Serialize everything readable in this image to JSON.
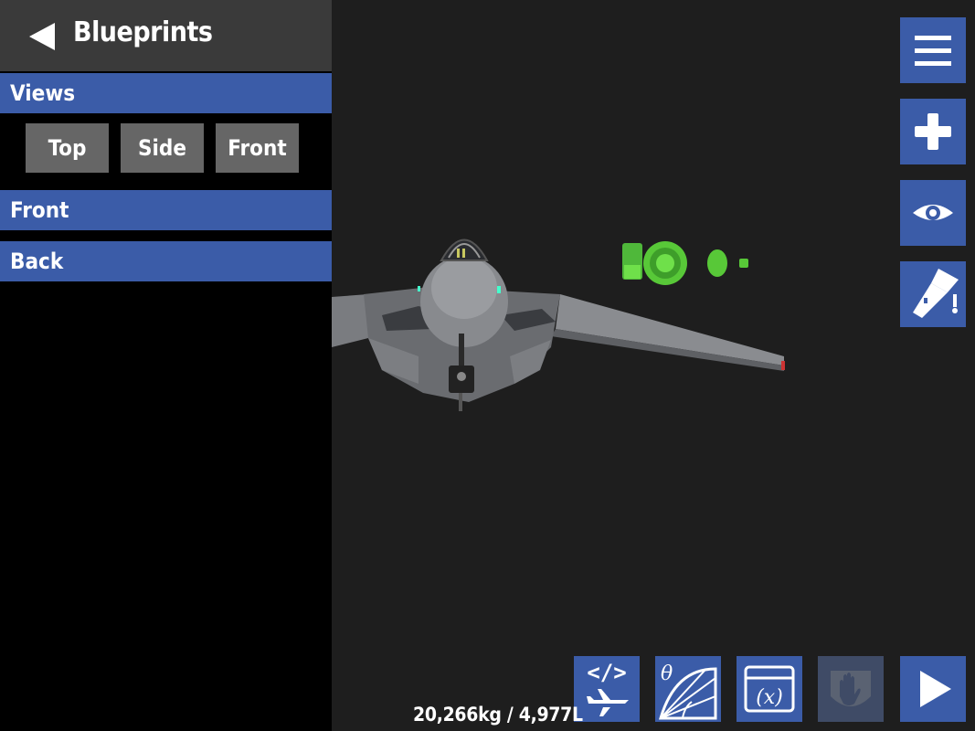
{
  "header": {
    "title": "Blueprints",
    "back_icon": "back-arrow-icon"
  },
  "views": {
    "label": "Views",
    "buttons": [
      "Top",
      "Side",
      "Front"
    ]
  },
  "sections": [
    {
      "label": "Front"
    },
    {
      "label": "Back"
    }
  ],
  "toolbar_right": [
    {
      "name": "menu",
      "icon": "hamburger-menu-icon"
    },
    {
      "name": "add-part",
      "icon": "plus-icon"
    },
    {
      "name": "view-options",
      "icon": "eye-icon"
    },
    {
      "name": "paint",
      "icon": "paint-brush-icon"
    }
  ],
  "toolbar_bottom": [
    {
      "name": "code",
      "icon": "code-airplane-icon",
      "text": "< / >"
    },
    {
      "name": "angle",
      "icon": "angle-theta-icon",
      "text": "θ"
    },
    {
      "name": "variables",
      "icon": "variables-icon",
      "text": "(x)"
    },
    {
      "name": "touch",
      "icon": "hand-icon",
      "disabled": true
    },
    {
      "name": "play",
      "icon": "play-icon"
    }
  ],
  "status": {
    "mass_fuel": "20,266kg / 4,977L"
  },
  "colors": {
    "accent": "#3b5ca8",
    "panel_bg": "#000000",
    "header_bg": "#3a3a3a",
    "viewport_bg": "#1e1e1e",
    "button_gray": "#666666",
    "selection_green": "#5ccc3a"
  }
}
